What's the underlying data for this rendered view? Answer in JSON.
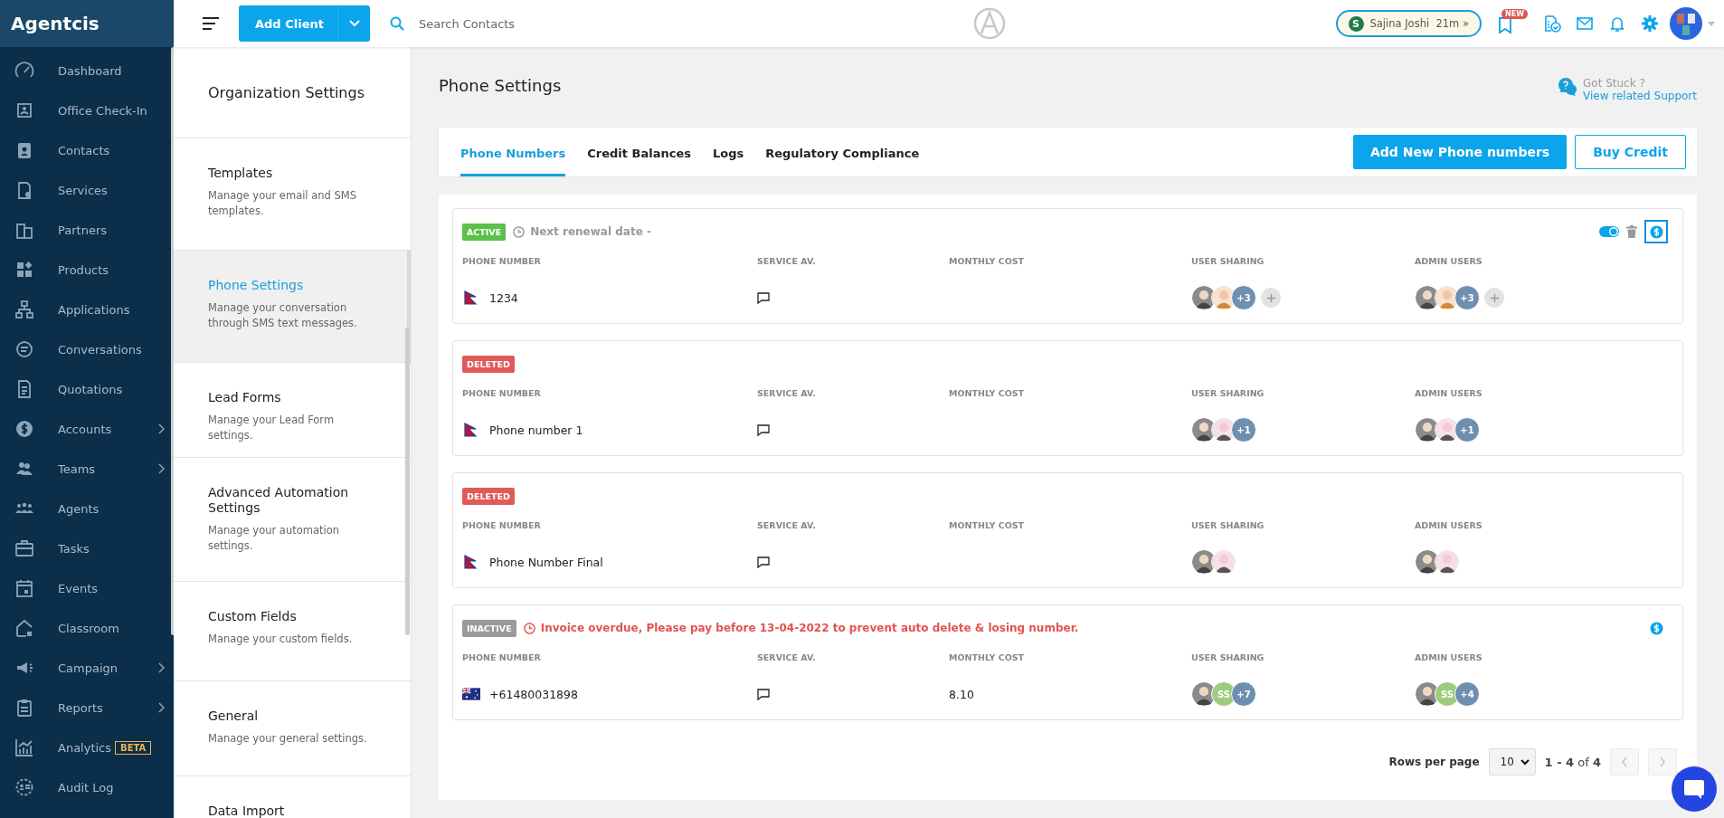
{
  "sidebar": {
    "brand": "Agentcis",
    "items": [
      {
        "label": "Dashboard",
        "selected": false,
        "submenu": false
      },
      {
        "label": "Office Check-In",
        "selected": false,
        "submenu": false
      },
      {
        "label": "Contacts",
        "selected": false,
        "submenu": false
      },
      {
        "label": "Services",
        "selected": false,
        "submenu": false
      },
      {
        "label": "Partners",
        "selected": false,
        "submenu": false
      },
      {
        "label": "Products",
        "selected": false,
        "submenu": false
      },
      {
        "label": "Applications",
        "selected": false,
        "submenu": false
      },
      {
        "label": "Conversations",
        "selected": false,
        "submenu": false
      },
      {
        "label": "Quotations",
        "selected": false,
        "submenu": false
      },
      {
        "label": "Accounts",
        "selected": false,
        "submenu": true
      },
      {
        "label": "Teams",
        "selected": false,
        "submenu": true
      },
      {
        "label": "Agents",
        "selected": false,
        "submenu": false
      },
      {
        "label": "Tasks",
        "selected": false,
        "submenu": false
      },
      {
        "label": "Events",
        "selected": false,
        "submenu": false
      },
      {
        "label": "Classroom",
        "selected": false,
        "submenu": false
      },
      {
        "label": "Campaign",
        "selected": false,
        "submenu": true
      },
      {
        "label": "Reports",
        "selected": false,
        "submenu": true
      },
      {
        "label": "Analytics",
        "selected": false,
        "submenu": false,
        "badge": "BETA"
      },
      {
        "label": "Audit Log",
        "selected": false,
        "submenu": false
      }
    ]
  },
  "topbar": {
    "add_button": "Add Client",
    "search": {
      "placeholder": "Search Contacts"
    },
    "timer": {
      "initial": "S",
      "label": "Sajina Joshi  21m »"
    },
    "new_badge": "NEW"
  },
  "settings": {
    "title": "Organization Settings",
    "items": [
      {
        "title": "Templates",
        "description": "Manage your email and SMS templates.",
        "selected": false
      },
      {
        "title": "Phone Settings",
        "description": "Manage your conversation through SMS text messages.",
        "selected": true
      },
      {
        "title": "Lead Forms",
        "description": "Manage your Lead Form settings.",
        "selected": false
      },
      {
        "title": "Advanced Automation Settings",
        "description": "Manage your automation settings.",
        "selected": false
      },
      {
        "title": "Custom Fields",
        "description": "Manage your custom fields.",
        "selected": false
      },
      {
        "title": "General",
        "description": "Manage your general settings.",
        "selected": false
      },
      {
        "title": "Data Import",
        "selected": false
      }
    ]
  },
  "page": {
    "title": "Phone Settings",
    "help": {
      "question": "Got Stuck ?",
      "link": "View related Support"
    }
  },
  "tabs": [
    {
      "label": "Phone Numbers",
      "selected": true
    },
    {
      "label": "Credit Balances",
      "selected": false
    },
    {
      "label": "Logs",
      "selected": false
    },
    {
      "label": "Regulatory Compliance",
      "selected": false
    }
  ],
  "buttons": [
    {
      "label": "Add New Phone numbers",
      "kind": "primary"
    },
    {
      "label": "Buy Credit",
      "kind": "outline"
    }
  ],
  "cards": [
    {
      "status": "ACTIVE",
      "kind": "active",
      "note": {
        "kind": "info",
        "text": "Next renewal date -"
      },
      "actions": [
        {
          "kind": "toggle",
          "on": true
        },
        {
          "kind": "trash"
        },
        {
          "kind": "billing",
          "selected": true
        }
      ],
      "columns": [
        "PHONE NUMBER",
        "SERVICE AV.",
        "MONTHLY COST",
        "USER SHARING",
        "ADMIN USERS"
      ],
      "flag": {
        "kind": "np"
      },
      "number": "1234",
      "user_sharing": [
        {
          "kind": "photo"
        },
        {
          "kind": "photo"
        },
        {
          "kind": "count",
          "text": "+3"
        },
        {
          "kind": "add"
        }
      ],
      "admin_users": [
        {
          "kind": "photo"
        },
        {
          "kind": "photo"
        },
        {
          "kind": "count",
          "text": "+3"
        },
        {
          "kind": "add"
        }
      ]
    },
    {
      "status": "DELETED",
      "kind": "deleted",
      "columns": [
        "PHONE NUMBER",
        "SERVICE AV.",
        "MONTHLY COST",
        "USER SHARING",
        "ADMIN USERS"
      ],
      "flag": {
        "kind": "np"
      },
      "number": "Phone number 1",
      "user_sharing": [
        {
          "kind": "photo"
        },
        {
          "kind": "photo"
        },
        {
          "kind": "count",
          "text": "+1"
        }
      ],
      "admin_users": [
        {
          "kind": "photo"
        },
        {
          "kind": "photo"
        },
        {
          "kind": "count",
          "text": "+1"
        }
      ]
    },
    {
      "status": "DELETED",
      "kind": "deleted",
      "columns": [
        "PHONE NUMBER",
        "SERVICE AV.",
        "MONTHLY COST",
        "USER SHARING",
        "ADMIN USERS"
      ],
      "flag": {
        "kind": "np"
      },
      "number": "Phone Number Final",
      "user_sharing": [
        {
          "kind": "photo"
        },
        {
          "kind": "photo"
        }
      ],
      "admin_users": [
        {
          "kind": "photo"
        },
        {
          "kind": "photo"
        }
      ]
    },
    {
      "status": "INACTIVE",
      "kind": "inactive",
      "note": {
        "kind": "warning",
        "text": "Invoice overdue, Please pay before 13-04-2022 to prevent auto delete & losing number."
      },
      "actions": [
        {
          "kind": "billing",
          "selected": false
        }
      ],
      "columns": [
        "PHONE NUMBER",
        "SERVICE AV.",
        "MONTHLY COST",
        "USER SHARING",
        "ADMIN USERS"
      ],
      "flag": {
        "kind": "au"
      },
      "number": "+61480031898",
      "cost": "8.10",
      "user_sharing": [
        {
          "kind": "photo"
        },
        {
          "kind": "initials",
          "text": "SS"
        },
        {
          "kind": "count",
          "text": "+7"
        }
      ],
      "admin_users": [
        {
          "kind": "photo"
        },
        {
          "kind": "initials",
          "text": "SS"
        },
        {
          "kind": "count",
          "text": "+4"
        }
      ]
    }
  ],
  "pagination": {
    "label": "Rows per page",
    "rows": "10",
    "range": "**1 - 4** of **4**",
    "prev": {
      "disabled": true
    },
    "next": {
      "disabled": true
    }
  }
}
